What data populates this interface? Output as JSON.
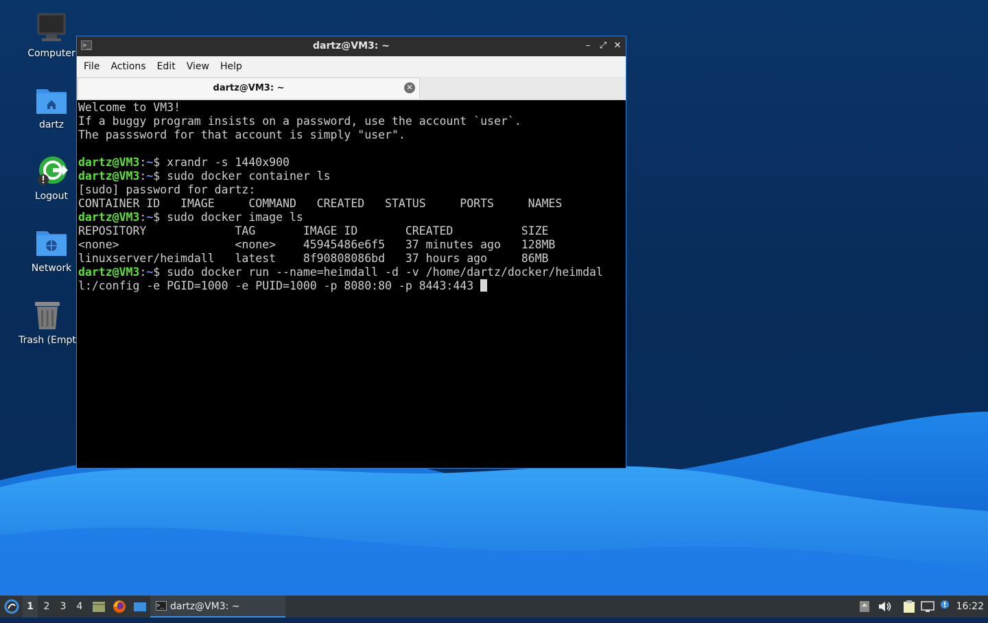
{
  "desktop": {
    "icons": [
      {
        "label": "Computer",
        "icon": "computer-icon"
      },
      {
        "label": "dartz",
        "icon": "home-folder-icon"
      },
      {
        "label": "Logout",
        "icon": "logout-icon"
      },
      {
        "label": "Network",
        "icon": "network-folder-icon"
      },
      {
        "label": "Trash (Empt",
        "icon": "trash-icon"
      }
    ],
    "accent": "#3b7fd0"
  },
  "window": {
    "title": "dartz@VM3: ~",
    "menu": [
      "File",
      "Actions",
      "Edit",
      "View",
      "Help"
    ],
    "tab_title": "dartz@VM3: ~",
    "buttons": {
      "minimize": "–",
      "maximize": "⤢",
      "close": "✕"
    }
  },
  "terminal": {
    "prompt_user": "dartz@VM3",
    "prompt_sep": ":",
    "prompt_path": "~",
    "prompt_sym": "$ ",
    "lines": [
      "Welcome to VM3!",
      "If a buggy program insists on a password, use the account `user`.",
      "The passsword for that account is simply \"user\".",
      "",
      {
        "cmd": "xrandr -s 1440x900"
      },
      {
        "cmd": "sudo docker container ls"
      },
      "[sudo] password for dartz:",
      "CONTAINER ID   IMAGE     COMMAND   CREATED   STATUS     PORTS     NAMES",
      {
        "cmd": "sudo docker image ls"
      },
      "REPOSITORY             TAG       IMAGE ID       CREATED          SIZE",
      "<none>                 <none>    45945486e6f5   37 minutes ago   128MB",
      "linuxserver/heimdall   latest    8f90808086bd   37 hours ago     86MB",
      {
        "cmd": "sudo docker run --name=heimdall -d -v /home/dartz/docker/heimdal"
      },
      "l:/config -e PGID=1000 -e PUID=1000 -p 8080:80 -p 8443:443 "
    ]
  },
  "taskbar": {
    "workspaces": [
      "1",
      "2",
      "3",
      "4"
    ],
    "active_workspace": "1",
    "task_label": "dartz@VM3: ~",
    "clock": "16:22"
  }
}
